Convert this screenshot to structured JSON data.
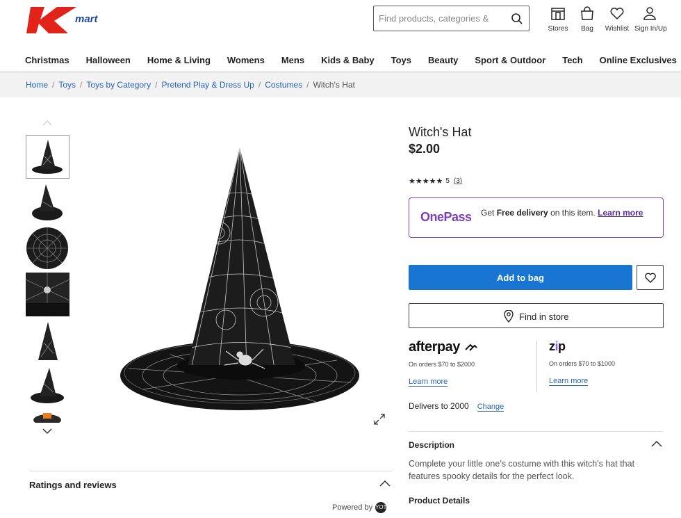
{
  "brand": {
    "name": "Kmart",
    "logo_letter": "K",
    "logo_word": "mart",
    "red": "#e2231a",
    "blue": "#1f4aa8"
  },
  "search": {
    "placeholder": "Find products, categories & "
  },
  "header_icons": [
    {
      "icon": "store-icon",
      "label": "Stores"
    },
    {
      "icon": "bag-icon",
      "label": "Bag"
    },
    {
      "icon": "heart-icon",
      "label": "Wishlist"
    },
    {
      "icon": "user-icon",
      "label": "Sign In/Up"
    }
  ],
  "nav": [
    "Christmas",
    "Halloween",
    "Home & Living",
    "Womens",
    "Mens",
    "Kids & Baby",
    "Toys",
    "Beauty",
    "Sport & Outdoor",
    "Tech",
    "Online Exclusives"
  ],
  "breadcrumb": {
    "links": [
      "Home",
      "Toys",
      "Toys by Category",
      "Pretend Play & Dress Up",
      "Costumes"
    ],
    "current": "Witch's Hat",
    "separator": "/"
  },
  "product": {
    "title": "Witch's Hat",
    "price": "$2.00",
    "stars": "★★★★★",
    "rating": "5",
    "review_count": "(3)"
  },
  "onepass": {
    "logo": "OnePass",
    "text_prefix": "Get ",
    "text_bold": "Free delivery",
    "text_suffix": " on this item. ",
    "learn_more": "Learn more",
    "color": "#7b3fb8"
  },
  "actions": {
    "add_to_bag": "Add to bag",
    "find_in_store": "Find in store"
  },
  "afterpay": {
    "logo": "afterpay",
    "sub": "On orders $70 to $2000",
    "learn_more": "Learn more"
  },
  "zip": {
    "logo_z": "z",
    "logo_i": "i",
    "logo_p": "p",
    "sub": "On orders $70 to $1000",
    "learn_more": "Learn more"
  },
  "delivery": {
    "text": "Delivers to 2000",
    "change": "Change"
  },
  "description": {
    "heading": "Description",
    "body": "Complete your little one's costume with this witch's hat that features spooky details for the perfect look."
  },
  "product_details": {
    "heading": "Product Details"
  },
  "ratings_section": {
    "heading": "Ratings and reviews",
    "powered_by": "Powered by",
    "badge": "YOT"
  },
  "colors": {
    "accent_blue": "#1876d2",
    "link_blue": "#2664b8"
  }
}
